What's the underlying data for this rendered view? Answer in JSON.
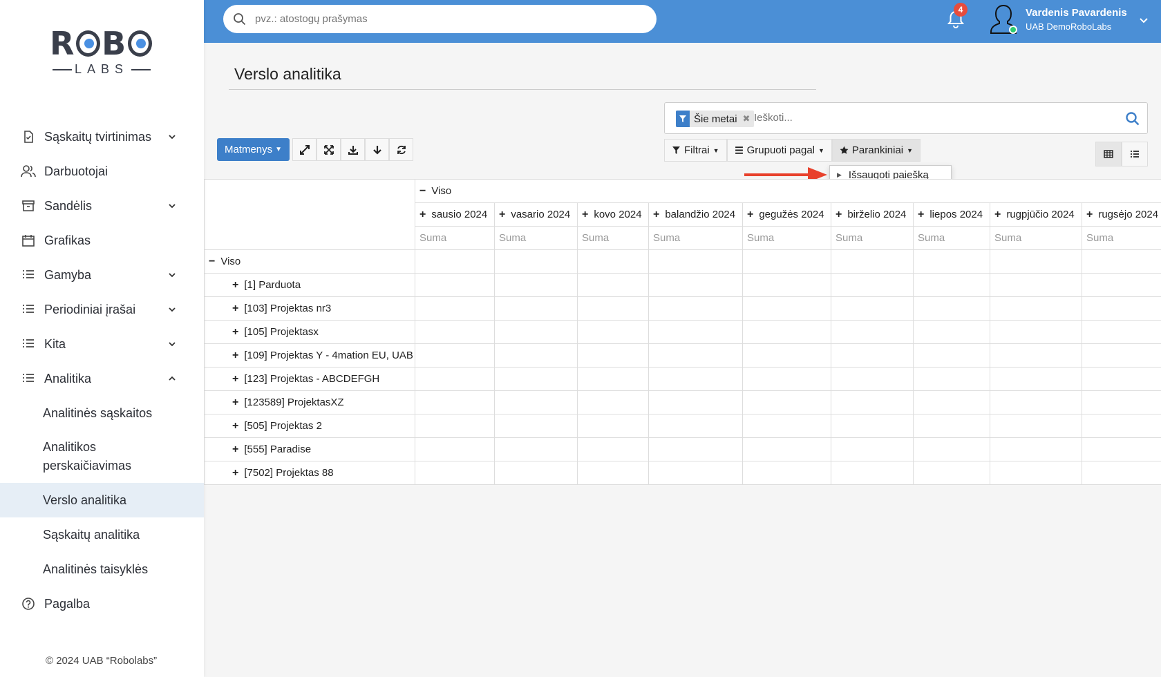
{
  "sidebar": {
    "logo_top": "ROBO",
    "logo_bottom": "LABS",
    "items": [
      {
        "label": "Sąskaitų tvirtinimas",
        "icon": "document-check-icon"
      },
      {
        "label": "Darbuotojai",
        "icon": "users-icon"
      },
      {
        "label": "Sandėlis",
        "icon": "archive-icon"
      },
      {
        "label": "Grafikas",
        "icon": "calendar-icon"
      },
      {
        "label": "Gamyba",
        "icon": "list-icon"
      },
      {
        "label": "Periodiniai įrašai",
        "icon": "list-icon"
      },
      {
        "label": "Kita",
        "icon": "list-icon"
      },
      {
        "label": "Analitika",
        "icon": "list-icon"
      }
    ],
    "sub_items": [
      {
        "label": "Analitinės sąskaitos"
      },
      {
        "label": "Analitikos perskaičiavimas"
      },
      {
        "label": "Verslo analitika"
      },
      {
        "label": "Sąskaitų analitika"
      },
      {
        "label": "Analitinės taisyklės"
      }
    ],
    "help": {
      "label": "Pagalba",
      "icon": "help-circle-icon"
    },
    "footer": "© 2024 UAB “Robolabs”"
  },
  "header": {
    "search_placeholder": "pvz.: atostogų prašymas",
    "notifications_count": "4",
    "user_name": "Vardenis Pavardenis",
    "company": "UAB DemoRoboLabs",
    "accent_color": "#4b8fd6"
  },
  "main": {
    "title": "Verslo analitika",
    "matmenys_label": "Matmenys",
    "facet_label": "Šie metai",
    "facet_search_placeholder": "Ieškoti...",
    "filters_label": "Filtrai",
    "group_label": "Grupuoti pagal",
    "favorites_label": "Parankiniai",
    "dropdown_item": "Išsaugoti paiešką"
  },
  "pivot": {
    "top_header": "Viso",
    "months": [
      "sausio 2024",
      "vasario 2024",
      "kovo 2024",
      "balandžio 2024",
      "gegužės 2024",
      "birželio 2024",
      "liepos 2024",
      "rugpjūčio 2024",
      "rugsėjo 2024"
    ],
    "measure": "Suma",
    "row_total": "Viso",
    "rows": [
      "[1] Parduota",
      "[103] Projektas nr3",
      "[105] Projektasx",
      "[109] Projektas Y - 4mation EU, UAB",
      "[123] Projektas - ABCDEFGH",
      "[123589] ProjektasXZ",
      "[505] Projektas 2",
      "[555] Paradise",
      "[7502] Projektas 88"
    ]
  }
}
